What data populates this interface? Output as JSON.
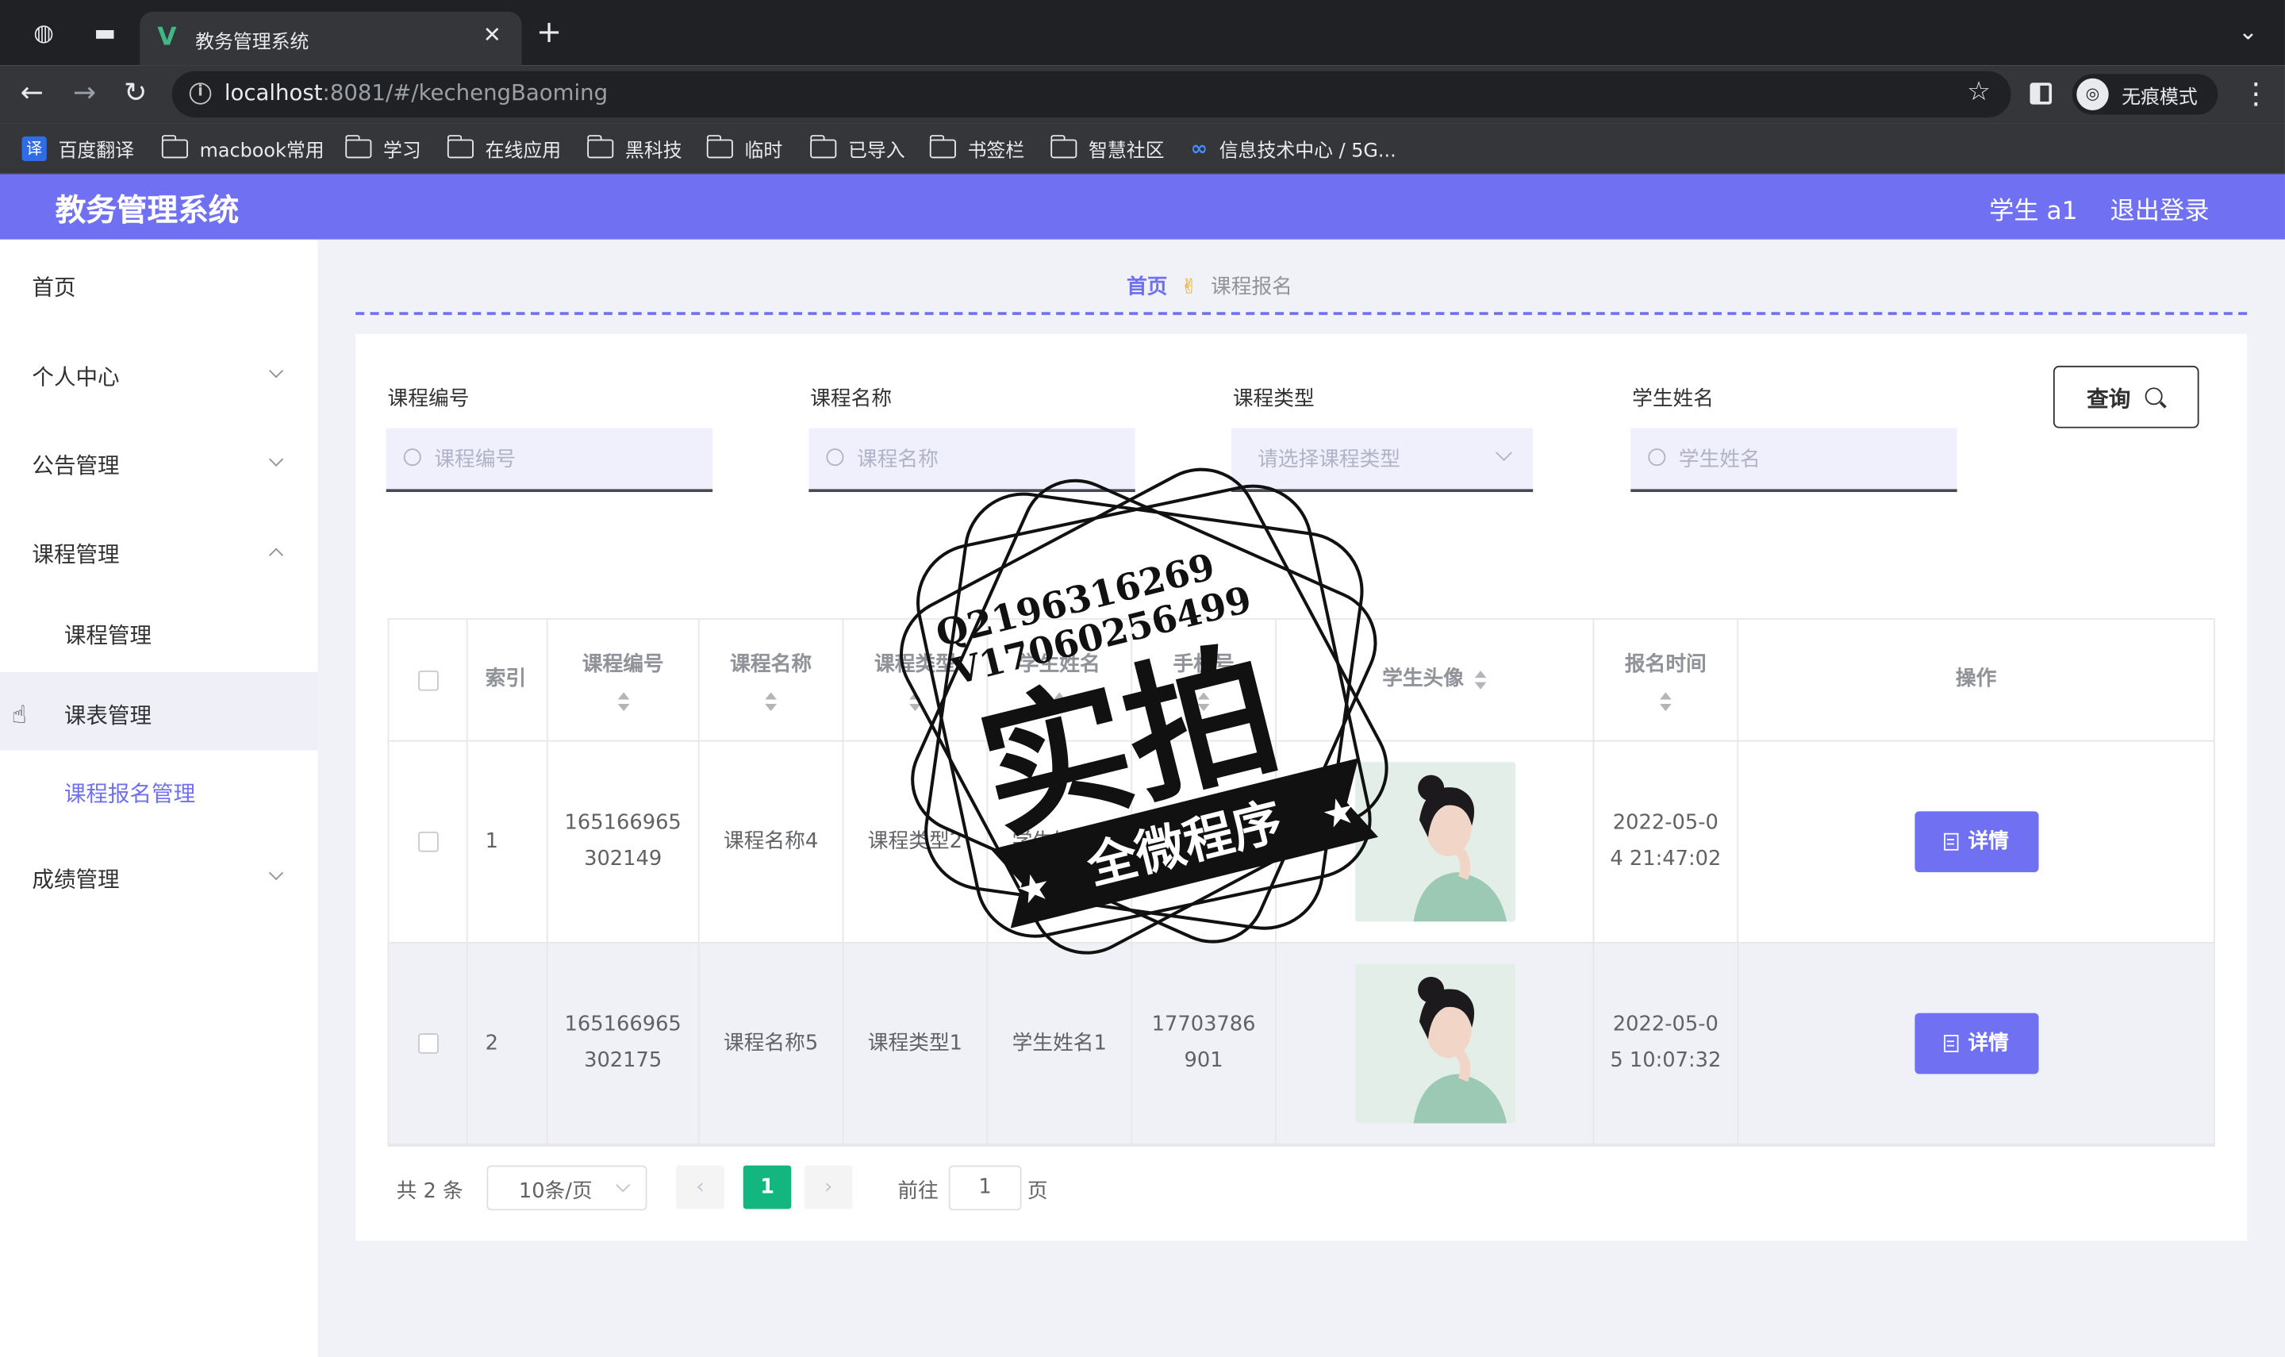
{
  "browser": {
    "tab_title": "教务管理系统",
    "url_host": "localhost",
    "url_path": ":8081/#/kechengBaoming",
    "incognito_label": "无痕模式",
    "bookmarks": [
      "百度翻译",
      "macbook常用",
      "学习",
      "在线应用",
      "黑科技",
      "临时",
      "已导入",
      "书签栏",
      "智慧社区",
      "信息技术中心 / 5G..."
    ]
  },
  "header": {
    "title": "教务管理系统",
    "user": "学生 a1",
    "logout": "退出登录"
  },
  "sidebar": {
    "items": [
      {
        "label": "首页"
      },
      {
        "label": "个人中心"
      },
      {
        "label": "公告管理"
      },
      {
        "label": "课程管理"
      },
      {
        "label": "课程管理"
      },
      {
        "label": "课表管理"
      },
      {
        "label": "课程报名管理"
      },
      {
        "label": "成绩管理"
      }
    ]
  },
  "breadcrumb": {
    "home": "首页",
    "separator": "✌",
    "current": "课程报名"
  },
  "filters": {
    "course_no": {
      "label": "课程编号",
      "placeholder": "课程编号"
    },
    "course_name": {
      "label": "课程名称",
      "placeholder": "课程名称"
    },
    "course_type": {
      "label": "课程类型",
      "placeholder": "请选择课程类型"
    },
    "student_name": {
      "label": "学生姓名",
      "placeholder": "学生姓名"
    },
    "query_button": "查询"
  },
  "table": {
    "columns": [
      "索引",
      "课程编号",
      "课程名称",
      "课程类型",
      "学生姓名",
      "手机号",
      "学生头像",
      "报名时间",
      "操作"
    ],
    "rows": [
      {
        "index": "1",
        "course_no": "165166965302149",
        "course_name": "课程名称4",
        "course_type": "课程类型2",
        "student_name": "学生姓名1",
        "phone": "17703786901",
        "time": "2022-05-04 21:47:02",
        "action": "详情"
      },
      {
        "index": "2",
        "course_no": "165166965302175",
        "course_name": "课程名称5",
        "course_type": "课程类型1",
        "student_name": "学生姓名1",
        "phone": "17703786901",
        "time": "2022-05-05 10:07:32",
        "action": "详情"
      }
    ]
  },
  "pagination": {
    "total": "共 2 条",
    "page_size": "10条/页",
    "current_page": "1",
    "goto_label": "前往",
    "goto_value": "1",
    "goto_unit": "页"
  },
  "watermark": {
    "line1": "Q2196316269",
    "line2": "V17060256499",
    "big": "实拍",
    "banner": "全微程序"
  },
  "colors": {
    "accent": "#6f70f2",
    "page_active": "#13b67f"
  }
}
